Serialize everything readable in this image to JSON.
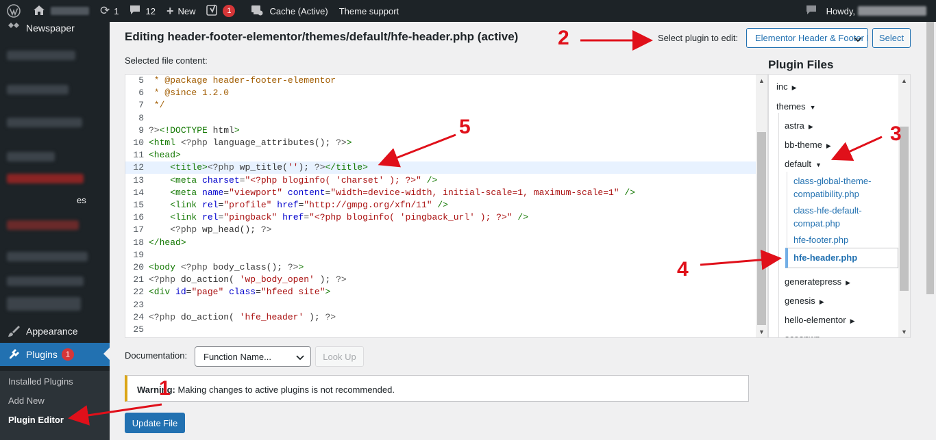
{
  "adminbar": {
    "updates_count": "1",
    "comments_count": "12",
    "new_label": "New",
    "seo_badge": "1",
    "cache_label": "Cache (Active)",
    "theme_support_label": "Theme support",
    "howdy_label": "Howdy,"
  },
  "sidebar": {
    "newspaper_label": "Newspaper",
    "partial_label": "es",
    "appearance_label": "Appearance",
    "plugins_label": "Plugins",
    "plugins_badge": "1",
    "submenu": {
      "installed": "Installed Plugins",
      "add_new": "Add New",
      "editor": "Plugin Editor"
    }
  },
  "header": {
    "title": "Editing header-footer-elementor/themes/default/hfe-header.php (active)",
    "selected_label": "Selected file content:",
    "select_plugin_label": "Select plugin to edit:",
    "select_plugin_value": "Elementor Header & Footer Builder",
    "select_button": "Select"
  },
  "editor": {
    "lines": [
      {
        "n": "5",
        "t": " * @package header-footer-elementor"
      },
      {
        "n": "6",
        "t": " * @since 1.2.0"
      },
      {
        "n": "7",
        "t": " */"
      },
      {
        "n": "8",
        "t": ""
      },
      {
        "n": "9",
        "t": "?><!DOCTYPE html>"
      },
      {
        "n": "10",
        "t": "<html <?php language_attributes(); ?>>"
      },
      {
        "n": "11",
        "t": "<head>"
      },
      {
        "n": "12",
        "t": "    <title><?php wp_title(''); ?></title>"
      },
      {
        "n": "13",
        "t": "    <meta charset=\"<?php bloginfo( 'charset' ); ?>\" />"
      },
      {
        "n": "14",
        "t": "    <meta name=\"viewport\" content=\"width=device-width, initial-scale=1, maximum-scale=1\" />"
      },
      {
        "n": "15",
        "t": "    <link rel=\"profile\" href=\"http://gmpg.org/xfn/11\" />"
      },
      {
        "n": "16",
        "t": "    <link rel=\"pingback\" href=\"<?php bloginfo( 'pingback_url' ); ?>\" />"
      },
      {
        "n": "17",
        "t": "    <?php wp_head(); ?>"
      },
      {
        "n": "18",
        "t": "</head>"
      },
      {
        "n": "19",
        "t": ""
      },
      {
        "n": "20",
        "t": "<body <?php body_class(); ?>>"
      },
      {
        "n": "21",
        "t": "<?php do_action( 'wp_body_open' ); ?>"
      },
      {
        "n": "22",
        "t": "<div id=\"page\" class=\"hfeed site\">"
      },
      {
        "n": "23",
        "t": ""
      },
      {
        "n": "24",
        "t": "<?php do_action( 'hfe_header' ); ?>"
      },
      {
        "n": "25",
        "t": ""
      }
    ]
  },
  "files": {
    "title": "Plugin Files",
    "inc": "inc",
    "themes": "themes",
    "astra": "astra",
    "bb_theme": "bb-theme",
    "default": "default",
    "f1": "class-global-theme-compatibility.php",
    "f2": "class-hfe-default-compat.php",
    "f3": "hfe-footer.php",
    "current": "hfe-header.php",
    "generatepress": "generatepress",
    "genesis": "genesis",
    "hello": "hello-elementor",
    "oceanwp": "oceanwp"
  },
  "documentation": {
    "label": "Documentation:",
    "select_value": "Function Name...",
    "lookup": "Look Up"
  },
  "notice": {
    "strong": "Warning:",
    "text": " Making changes to active plugins is not recommended."
  },
  "update_button": "Update File",
  "annotations": [
    "1",
    "2",
    "3",
    "4",
    "5"
  ],
  "colors": {
    "adminbar": "#1d2327",
    "accent": "#2271b1",
    "annotation_red": "#e0101a",
    "warning": "#dba617"
  }
}
